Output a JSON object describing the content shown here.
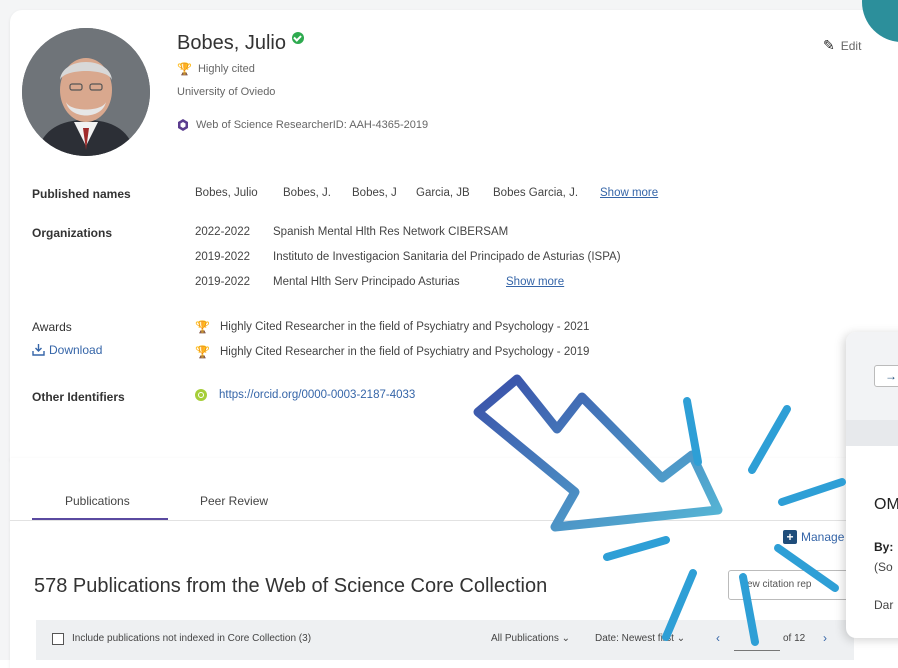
{
  "profile": {
    "name": "Bobes, Julio",
    "badge": "Highly cited",
    "affiliation": "University of Oviedo",
    "researcher_id": "Web of Science ResearcherID: AAH-4365-2019",
    "edit_label": "Edit"
  },
  "published_names": {
    "label": "Published names",
    "names": [
      "Bobes, Julio",
      "Bobes, J.",
      "Bobes, J",
      "Garcia, JB",
      "Bobes Garcia, J."
    ],
    "show_more": "Show more"
  },
  "organizations": {
    "label": "Organizations",
    "items": [
      {
        "years": "2022-2022",
        "name": "Spanish Mental Hlth Res Network CIBERSAM"
      },
      {
        "years": "2019-2022",
        "name": "Instituto de Investigacion Sanitaria del Principado de Asturias (ISPA)"
      },
      {
        "years": "2019-2022",
        "name": "Mental Hlth Serv Principado Asturias"
      }
    ],
    "show_more": "Show more"
  },
  "awards": {
    "label": "Awards",
    "download_label": "Download",
    "items": [
      "Highly Cited Researcher in the field of Psychiatry and Psychology - 2021",
      "Highly Cited Researcher in the field of Psychiatry and Psychology - 2019"
    ]
  },
  "other_identifiers": {
    "label": "Other Identifiers",
    "orcid": "https://orcid.org/0000-0003-2187-4033"
  },
  "tabs": [
    {
      "label": "Publications",
      "active": true
    },
    {
      "label": "Peer Review",
      "active": false
    }
  ],
  "manage_label": "Manage",
  "publications_heading": "578 Publications from the Web of Science Core Collection",
  "citation_report_label": "ew citation rep",
  "filter_bar": {
    "include_label": "Include publications not indexed in Core Collection (3)",
    "all_publications": "All Publications",
    "date_sort": "Date: Newest first",
    "prev": "‹",
    "next": "›",
    "of_pages": "of 12"
  },
  "overlay": {
    "button_icon": "→",
    "title_partial": "OM",
    "by_partial": "By:",
    "source_partial": "(So",
    "date_partial": "Dar"
  },
  "colors": {
    "link": "#3565a8",
    "tab_underline": "#5a4aa0",
    "trophy": "#d9452b",
    "verified": "#2eaa4f",
    "orcid": "#a6ce39",
    "teal": "#2c8f9b",
    "arrow_start": "#3a4fa8",
    "arrow_end": "#2ea6d9"
  },
  "icons": {
    "verified": "check-circle-icon",
    "trophy": "trophy-icon",
    "wos": "web-of-science-icon",
    "pencil": "pencil-icon",
    "download": "download-icon",
    "orcid": "orcid-icon",
    "plus": "plus-box-icon",
    "chevron_down": "chevron-down-icon"
  }
}
